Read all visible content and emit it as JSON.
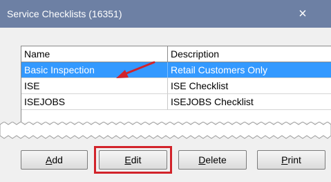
{
  "window": {
    "title": "Service Checklists (16351)",
    "close_glyph": "×"
  },
  "grid": {
    "columns": [
      "Name",
      "Description"
    ],
    "rows": [
      {
        "name": "Basic Inspection",
        "description": "Retail Customers Only",
        "selected": true
      },
      {
        "name": "ISE",
        "description": "ISE Checklist",
        "selected": false
      },
      {
        "name": "ISEJOBS",
        "description": "ISEJOBS Checklist",
        "selected": false
      }
    ]
  },
  "buttons": {
    "add": {
      "underline": "A",
      "rest": "dd"
    },
    "edit": {
      "underline": "E",
      "rest": "dit"
    },
    "delete": {
      "underline": "D",
      "rest": "elete"
    },
    "print": {
      "underline": "P",
      "rest": "rint"
    }
  },
  "colors": {
    "titlebar": "#6d80a4",
    "selection": "#3399ff",
    "callout": "#d2232a"
  },
  "icons": {
    "close": "close-icon",
    "annotation_arrow": "arrow-icon"
  }
}
